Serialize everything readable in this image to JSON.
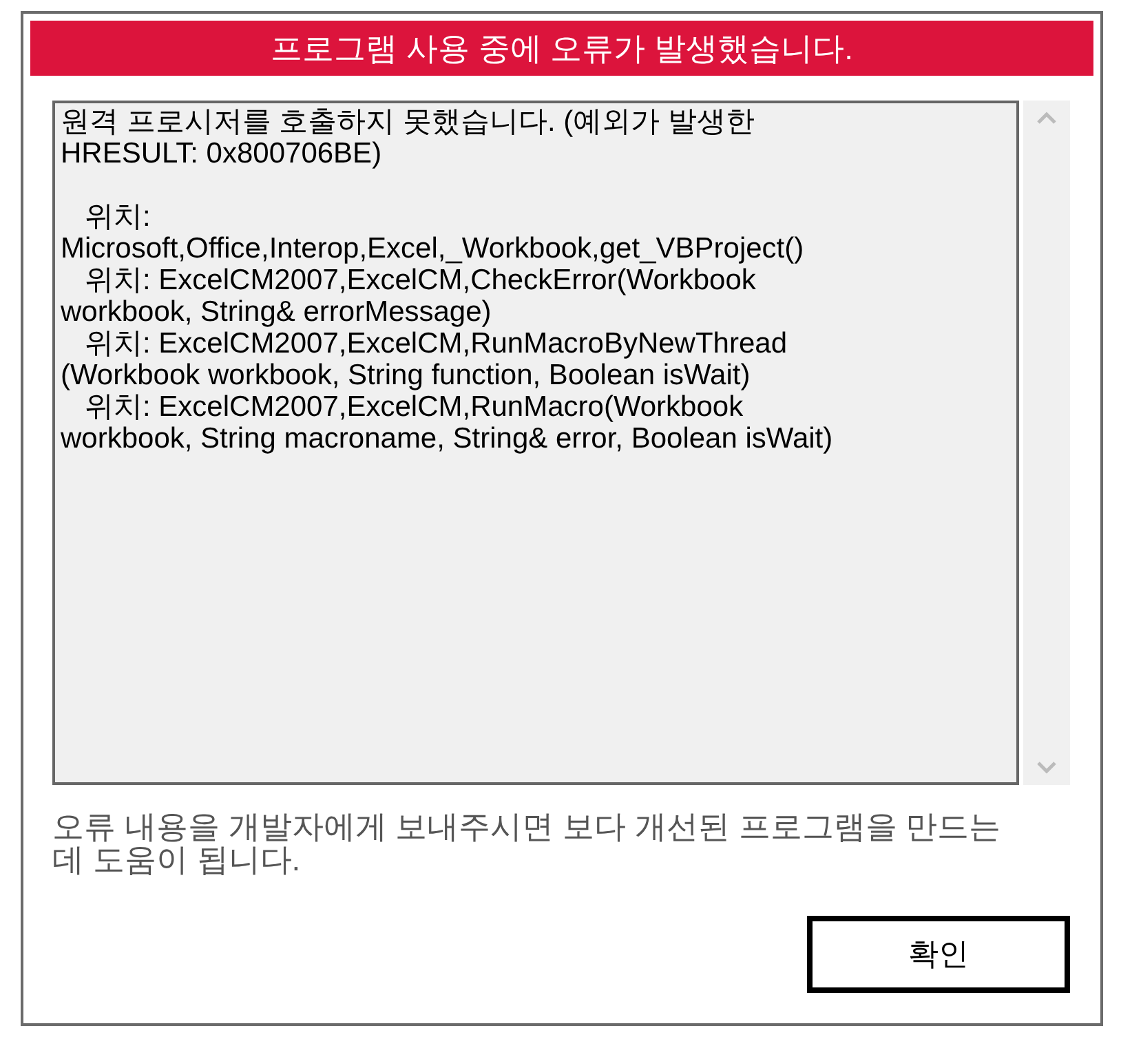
{
  "dialog": {
    "title": "프로그램 사용 중에 오류가 발생했습니다.",
    "error_details": "원격 프로시저를 호출하지 못했습니다. (예외가 발생한\nHRESULT: 0x800706BE)\n\n   위치:\nMicrosoft,Office,Interop,Excel,_Workbook,get_VBProject()\n   위치: ExcelCM2007,ExcelCM,CheckError(Workbook\nworkbook, String& errorMessage)\n   위치: ExcelCM2007,ExcelCM,RunMacroByNewThread\n(Workbook workbook, String function, Boolean isWait)\n   위치: ExcelCM2007,ExcelCM,RunMacro(Workbook\nworkbook, String macroname, String& error, Boolean isWait)",
    "message": "오류 내용을 개발자에게 보내주시면 보다 개선된 프로그램을 만드는\n데 도움이 됩니다.",
    "buttons": [
      "확인"
    ]
  }
}
